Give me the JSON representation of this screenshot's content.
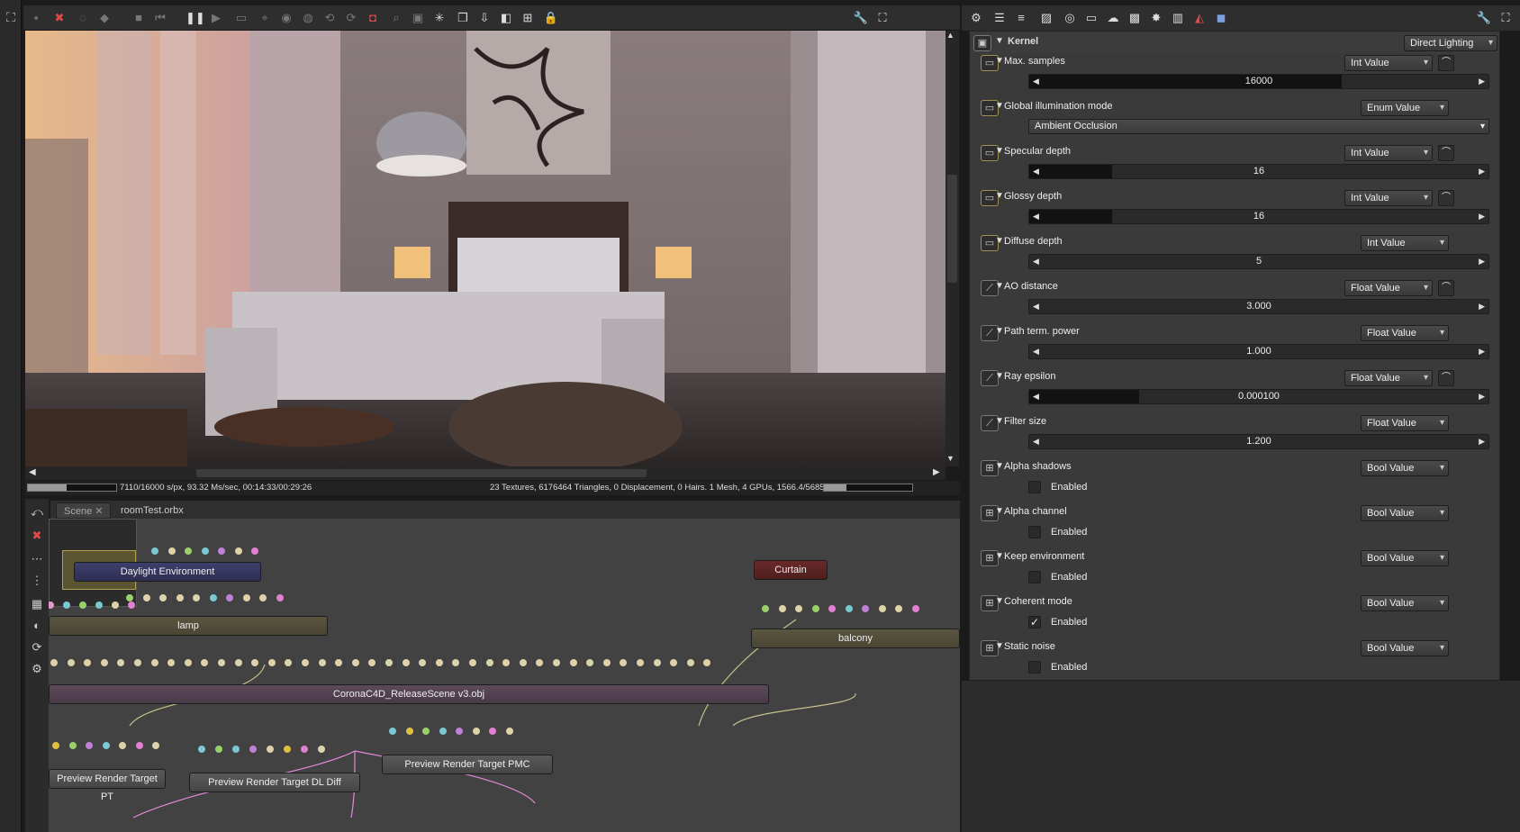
{
  "viewport": {
    "status_left": "7110/16000 s/px, 93.32 Ms/sec, 00:14:33/00:29:26",
    "status_right": "23 Textures, 6176464 Triangles, 0 Displacement, 0 Hairs. 1 Mesh, 4 GPUs, 1566.4/5685/6144 MB",
    "progress": 0.44
  },
  "node_editor": {
    "tabs": [
      "Scene",
      "roomTest.orbx"
    ],
    "nodes": {
      "daylight": "Daylight Environment",
      "lamp": "lamp",
      "curtain": "Curtain",
      "balcony": "balcony",
      "scene_obj": "CoronaC4D_ReleaseScene v3.obj",
      "rt_pt": "Preview Render Target PT",
      "rt_dl": "Preview Render Target DL Diff",
      "rt_pmc": "Preview Render Target PMC"
    }
  },
  "kernel": {
    "title": "Kernel",
    "mode": "Direct Lighting",
    "params": [
      {
        "name": "Max. samples",
        "type": "Int Value",
        "kind": "slider",
        "value": "16000",
        "fill": 0.68,
        "curve": true,
        "icon": "int"
      },
      {
        "name": "Global illumination mode",
        "type": "Enum Value",
        "kind": "enum",
        "value": "Ambient Occlusion",
        "curve": false,
        "icon": "int"
      },
      {
        "name": "Specular depth",
        "type": "Int Value",
        "kind": "slider",
        "value": "16",
        "fill": 0.18,
        "curve": true,
        "icon": "int"
      },
      {
        "name": "Glossy depth",
        "type": "Int Value",
        "kind": "slider",
        "value": "16",
        "fill": 0.18,
        "curve": true,
        "icon": "int"
      },
      {
        "name": "Diffuse depth",
        "type": "Int Value",
        "kind": "slider",
        "value": "5",
        "fill": 0.0,
        "curve": false,
        "icon": "int"
      },
      {
        "name": "AO distance",
        "type": "Float Value",
        "kind": "slider",
        "value": "3.000",
        "fill": 0.0,
        "curve": true,
        "icon": "float"
      },
      {
        "name": "Path term. power",
        "type": "Float Value",
        "kind": "slider",
        "value": "1.000",
        "fill": 0.0,
        "curve": false,
        "icon": "float"
      },
      {
        "name": "Ray epsilon",
        "type": "Float Value",
        "kind": "slider",
        "value": "0.000100",
        "fill": 0.24,
        "curve": true,
        "icon": "float"
      },
      {
        "name": "Filter size",
        "type": "Float Value",
        "kind": "slider",
        "value": "1.200",
        "fill": 0.0,
        "curve": false,
        "icon": "float"
      },
      {
        "name": "Alpha shadows",
        "type": "Bool Value",
        "kind": "bool",
        "value": "Enabled",
        "checked": false,
        "curve": false,
        "icon": "bool"
      },
      {
        "name": "Alpha channel",
        "type": "Bool Value",
        "kind": "bool",
        "value": "Enabled",
        "checked": false,
        "curve": false,
        "icon": "bool"
      },
      {
        "name": "Keep environment",
        "type": "Bool Value",
        "kind": "bool",
        "value": "Enabled",
        "checked": false,
        "curve": false,
        "icon": "bool"
      },
      {
        "name": "Coherent mode",
        "type": "Bool Value",
        "kind": "bool",
        "value": "Enabled",
        "checked": true,
        "curve": false,
        "icon": "bool"
      },
      {
        "name": "Static noise",
        "type": "Bool Value",
        "kind": "bool",
        "value": "Enabled",
        "checked": false,
        "curve": false,
        "icon": "bool"
      }
    ]
  }
}
